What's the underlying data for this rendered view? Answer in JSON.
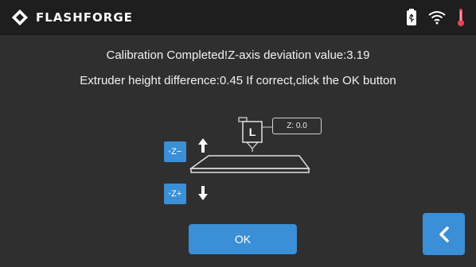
{
  "header": {
    "brand": "FLASHFORGE",
    "icons": [
      "flashforge-logo-icon",
      "usb-drive-icon",
      "wifi-icon",
      "thermometer-icon"
    ]
  },
  "message": {
    "line1": "Calibration Completed!Z-axis deviation value:3.19",
    "line2": "Extruder height difference:0.45  If correct,click the OK button"
  },
  "calibration": {
    "nozzle_label": "L",
    "z_readout": "Z:  0.0",
    "z_minus_label": "Z−",
    "z_plus_label": "Z+",
    "z_minus_prefix": "•",
    "z_plus_prefix": "•"
  },
  "actions": {
    "ok_label": "OK",
    "back_icon": "chevron-left-icon"
  },
  "colors": {
    "accent": "#3a8fd6",
    "background": "#2f2f2f",
    "header": "#1e1e1e",
    "thermometer": "#e0455a"
  }
}
